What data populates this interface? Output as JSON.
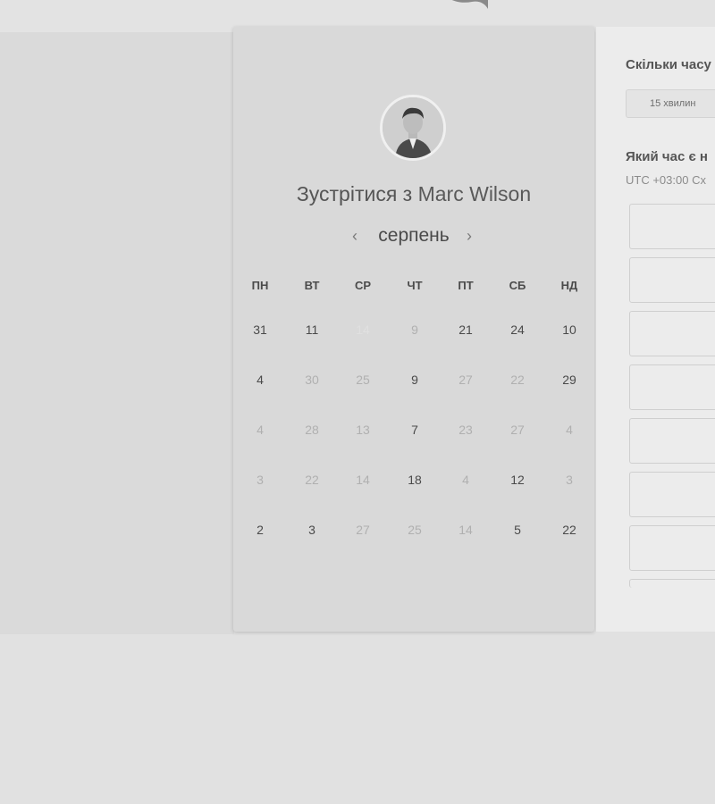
{
  "page": {
    "background": "#e1e1e1"
  },
  "calendar": {
    "title_prefix": "Зустрітися з ",
    "host_name": "Marc Wilson",
    "month": "серпень",
    "prev_label": "‹",
    "next_label": "›",
    "weekdays": [
      "ПН",
      "ВТ",
      "СР",
      "ЧТ",
      "ПТ",
      "СБ",
      "НД"
    ],
    "weeks": [
      [
        {
          "d": "31",
          "s": "normal"
        },
        {
          "d": "11",
          "s": "normal"
        },
        {
          "d": "14",
          "s": "selected"
        },
        {
          "d": "9",
          "s": "muted"
        },
        {
          "d": "21",
          "s": "normal"
        },
        {
          "d": "24",
          "s": "normal"
        },
        {
          "d": "10",
          "s": "normal"
        }
      ],
      [
        {
          "d": "4",
          "s": "normal"
        },
        {
          "d": "30",
          "s": "muted"
        },
        {
          "d": "25",
          "s": "muted"
        },
        {
          "d": "9",
          "s": "normal"
        },
        {
          "d": "27",
          "s": "muted"
        },
        {
          "d": "22",
          "s": "muted"
        },
        {
          "d": "29",
          "s": "normal"
        }
      ],
      [
        {
          "d": "4",
          "s": "muted"
        },
        {
          "d": "28",
          "s": "muted"
        },
        {
          "d": "13",
          "s": "muted"
        },
        {
          "d": "7",
          "s": "normal"
        },
        {
          "d": "23",
          "s": "muted"
        },
        {
          "d": "27",
          "s": "muted"
        },
        {
          "d": "4",
          "s": "muted"
        }
      ],
      [
        {
          "d": "3",
          "s": "muted"
        },
        {
          "d": "22",
          "s": "muted"
        },
        {
          "d": "14",
          "s": "muted"
        },
        {
          "d": "18",
          "s": "normal"
        },
        {
          "d": "4",
          "s": "muted"
        },
        {
          "d": "12",
          "s": "normal"
        },
        {
          "d": "3",
          "s": "muted"
        }
      ],
      [
        {
          "d": "2",
          "s": "normal"
        },
        {
          "d": "3",
          "s": "normal"
        },
        {
          "d": "27",
          "s": "muted"
        },
        {
          "d": "25",
          "s": "muted"
        },
        {
          "d": "14",
          "s": "muted"
        },
        {
          "d": "5",
          "s": "normal"
        },
        {
          "d": "22",
          "s": "normal"
        }
      ]
    ]
  },
  "booking": {
    "duration_question": "Скільки часу",
    "duration_option": "15 хвилин",
    "time_question": "Який час є н",
    "timezone": "UTC +03:00 Сх",
    "slot_count": 8
  }
}
